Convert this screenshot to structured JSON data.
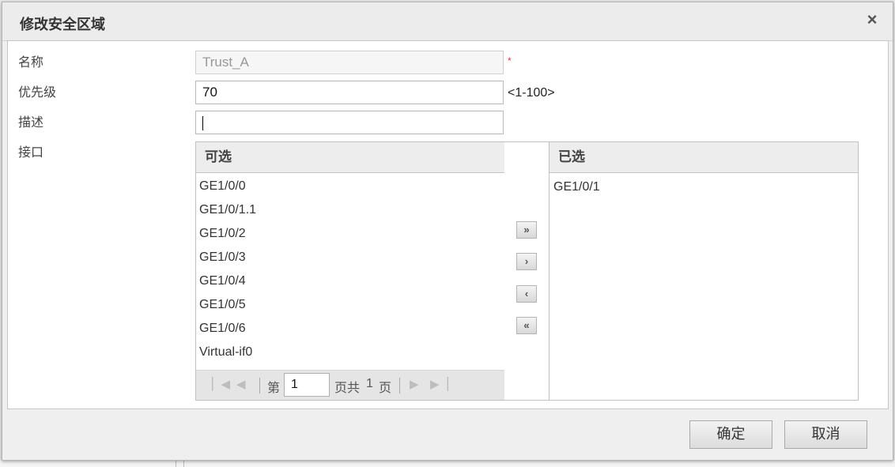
{
  "dialog": {
    "title": "修改安全区域",
    "close_icon": "×"
  },
  "form": {
    "name_label": "名称",
    "name_value": "Trust_A",
    "required_mark": "*",
    "priority_label": "优先级",
    "priority_value": "70",
    "priority_hint": "<1-100>",
    "desc_label": "描述",
    "desc_value": "",
    "interface_label": "接口"
  },
  "available": {
    "header": "可选",
    "items": [
      "GE1/0/0",
      "GE1/0/1.1",
      "GE1/0/2",
      "GE1/0/3",
      "GE1/0/4",
      "GE1/0/5",
      "GE1/0/6",
      "Virtual-if0"
    ]
  },
  "pager": {
    "page_prefix": "第",
    "current_page": "1",
    "page_suffix": "页共",
    "total_pages": "1",
    "total_suffix": "页",
    "icons": {
      "first": "first-page-icon",
      "prev": "prev-page-icon",
      "next": "next-page-icon",
      "last": "last-page-icon"
    }
  },
  "move_buttons": {
    "add_all": "»",
    "add_one": "›",
    "remove_one": "‹",
    "remove_all": "«"
  },
  "selected": {
    "header": "已选",
    "items": [
      "GE1/0/1"
    ]
  },
  "footer": {
    "confirm": "确定",
    "cancel": "取消"
  }
}
